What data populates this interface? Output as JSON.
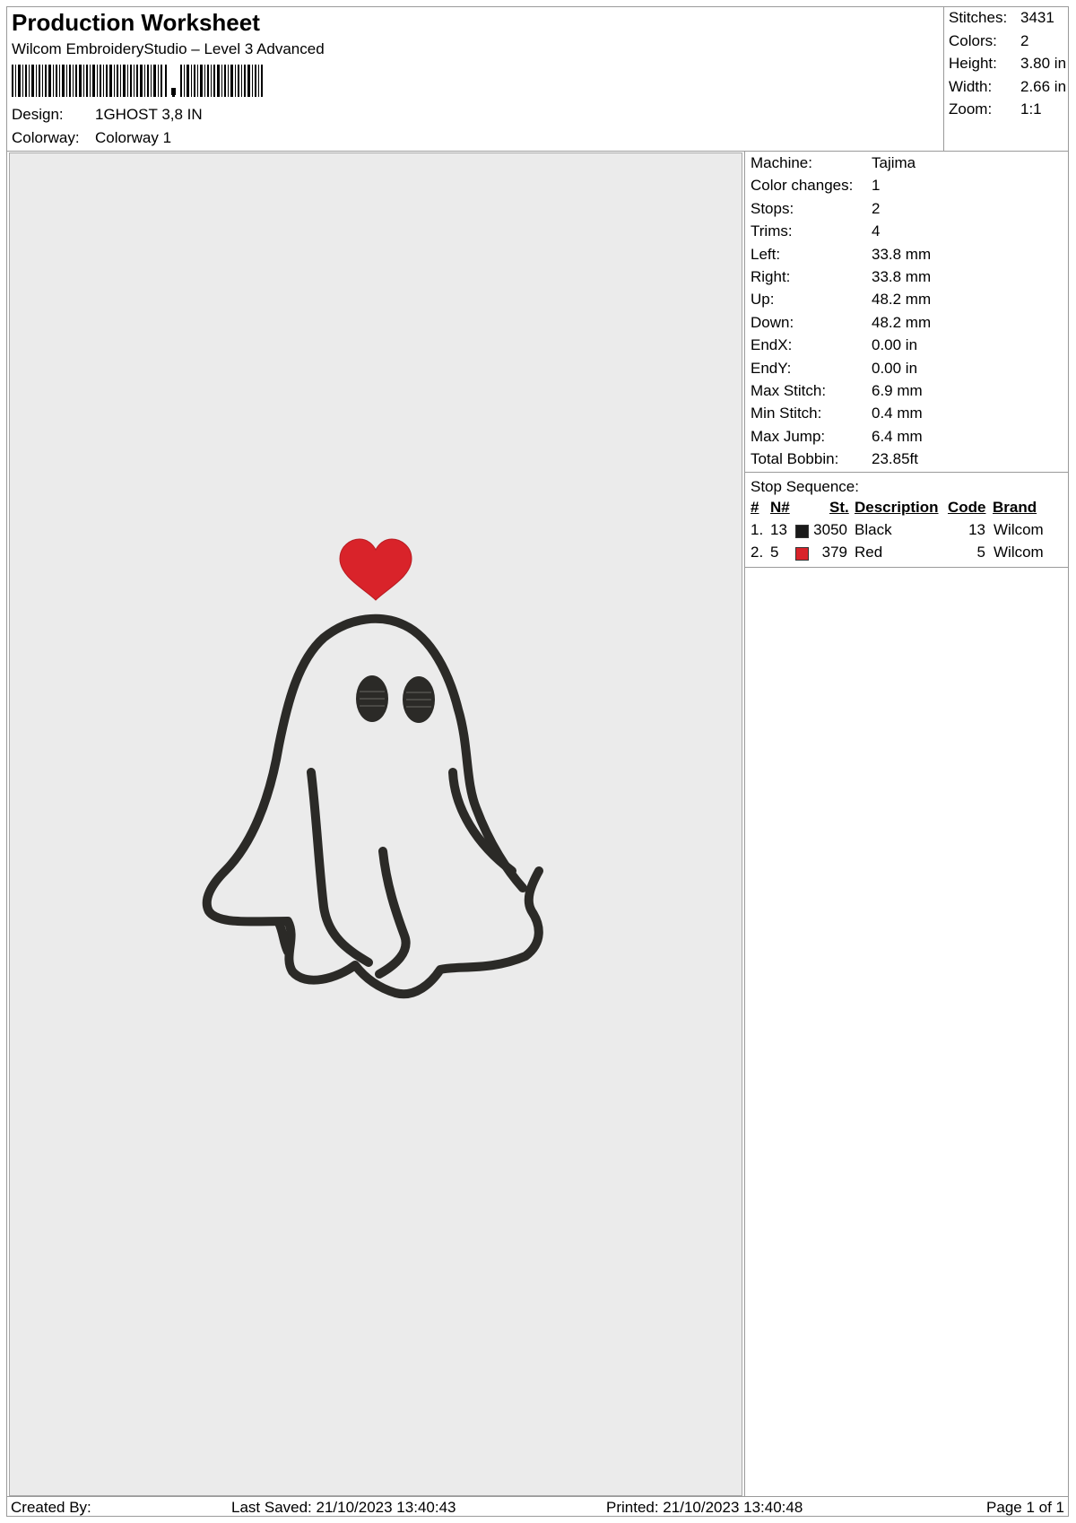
{
  "header": {
    "title": "Production Worksheet",
    "subtitle": "Wilcom EmbroideryStudio – Level 3 Advanced",
    "design_label": "Design:",
    "design_value": "1GHOST 3,8 IN",
    "colorway_label": "Colorway:",
    "colorway_value": "Colorway 1"
  },
  "summary": {
    "stitches_label": "Stitches:",
    "stitches": "3431",
    "colors_label": "Colors:",
    "colors": "2",
    "height_label": "Height:",
    "height": "3.80 in",
    "width_label": "Width:",
    "width": "2.66 in",
    "zoom_label": "Zoom:",
    "zoom": "1:1"
  },
  "details": [
    {
      "label": "Machine:",
      "value": "Tajima"
    },
    {
      "label": "Color changes:",
      "value": "1"
    },
    {
      "label": "Stops:",
      "value": "2"
    },
    {
      "label": "Trims:",
      "value": "4"
    },
    {
      "label": "Left:",
      "value": "33.8 mm"
    },
    {
      "label": "Right:",
      "value": "33.8 mm"
    },
    {
      "label": "Up:",
      "value": "48.2 mm"
    },
    {
      "label": "Down:",
      "value": "48.2 mm"
    },
    {
      "label": "EndX:",
      "value": "0.00 in"
    },
    {
      "label": "EndY:",
      "value": "0.00 in"
    },
    {
      "label": "Max Stitch:",
      "value": "6.9 mm"
    },
    {
      "label": "Min Stitch:",
      "value": "0.4 mm"
    },
    {
      "label": "Max Jump:",
      "value": "6.4 mm"
    },
    {
      "label": "Total Bobbin:",
      "value": "23.85ft"
    }
  ],
  "stop_sequence": {
    "label": "Stop Sequence:",
    "headers": {
      "num": "#",
      "needle": "N#",
      "stitches": "St.",
      "description": "Description",
      "code": "Code",
      "brand": "Brand"
    },
    "rows": [
      {
        "num": "1.",
        "needle": "13",
        "color": "#1a1a1a",
        "stitches": "3050",
        "description": "Black",
        "code": "13",
        "brand": "Wilcom"
      },
      {
        "num": "2.",
        "needle": "5",
        "color": "#d9232a",
        "stitches": "379",
        "description": "Red",
        "code": "5",
        "brand": "Wilcom"
      }
    ]
  },
  "footer": {
    "created_by": "Created By:",
    "last_saved": "Last Saved: 21/10/2023 13:40:43",
    "printed": "Printed: 21/10/2023 13:40:48",
    "page": "Page 1 of 1"
  },
  "colors": {
    "thread_black": "#2b2a27",
    "thread_red": "#d9232a",
    "canvas_bg": "#ebebeb"
  }
}
